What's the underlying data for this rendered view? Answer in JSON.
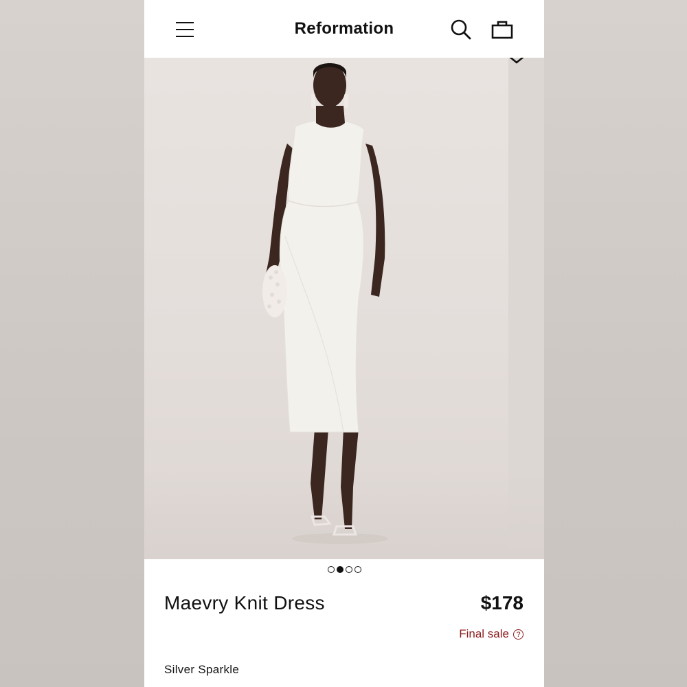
{
  "header": {
    "brand": "Reformation",
    "menu_icon": "hamburger-menu-icon",
    "search_icon": "search-icon",
    "bag_icon": "shopping-bag-icon"
  },
  "hero": {
    "image_subject": "model wearing white sleeveless knit midi dress",
    "chevron_icon": "chevron-down-icon"
  },
  "carousel": {
    "count": 4,
    "active_index": 1
  },
  "product": {
    "name": "Maevry Knit Dress",
    "price": "$178",
    "final_sale_label": "Final sale",
    "help_glyph": "?",
    "color": "Silver Sparkle"
  },
  "colors": {
    "text": "#111111",
    "final_sale": "#8d1e1e",
    "hero_background": "#e6e0dd",
    "page_background": "#d3cdc9"
  }
}
